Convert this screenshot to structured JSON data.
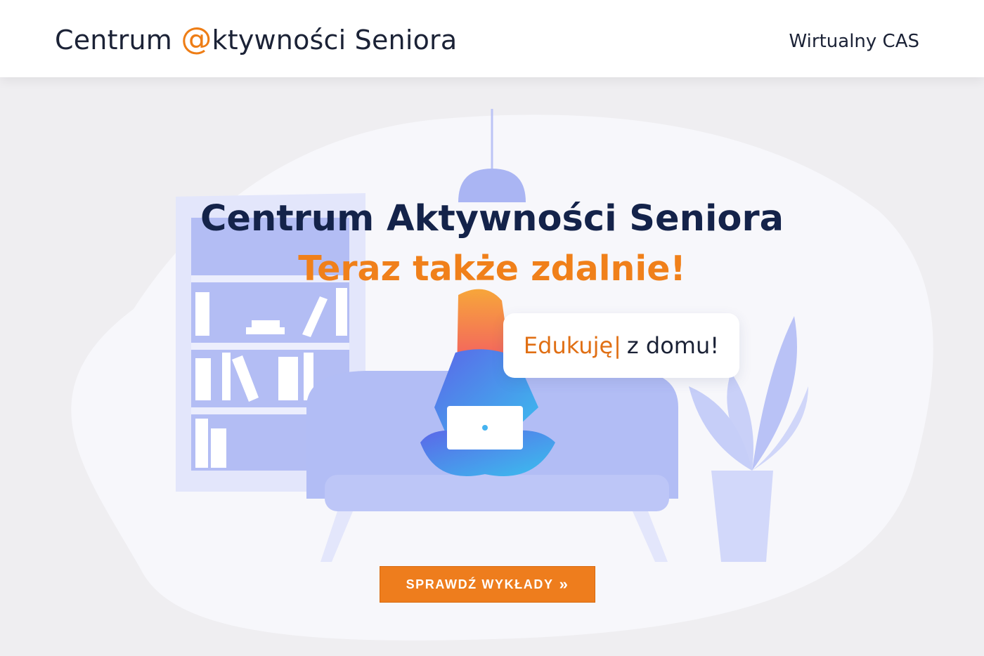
{
  "header": {
    "brand_prefix": "Centrum ",
    "brand_at": "@",
    "brand_suffix": "ktywności Seniora",
    "nav_link": "Wirtualny CAS"
  },
  "hero": {
    "title": "Centrum Aktywności Seniora",
    "subtitle": "Teraz także zdalnie!",
    "bubble_orange": "Edukuję",
    "bubble_cursor": "|",
    "bubble_dark": "z domu!",
    "cta_label": "SPRAWDŹ WYKŁADY",
    "cta_icon": "»"
  },
  "colors": {
    "accent": "#ee7d1d",
    "title": "#14234a",
    "illustration": "#a9b4f2",
    "background": "#efeef1"
  }
}
